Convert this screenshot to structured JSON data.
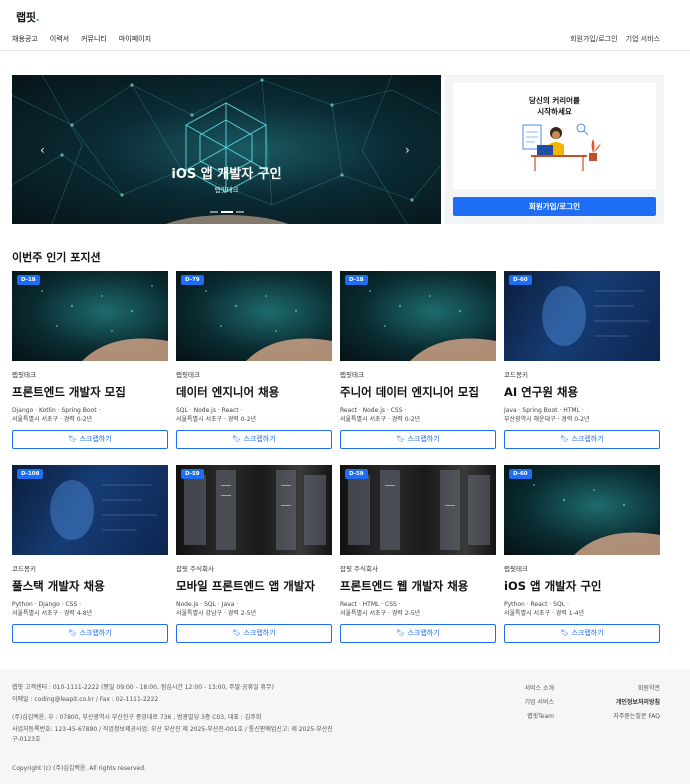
{
  "header": {
    "logo": "랩핏",
    "logo_dot": ".",
    "nav": [
      "채용공고",
      "이력서",
      "커뮤니티",
      "마이페이지"
    ],
    "right": [
      "회원가입/로그인",
      "기업 서비스"
    ]
  },
  "hero": {
    "title": "iOS 앱 개발자 구인",
    "subtitle": "랩핏테크",
    "prev": "‹",
    "next": "›"
  },
  "side": {
    "line1": "당신의 커리어를",
    "line2": "시작하세요",
    "button": "회원가입/로그인"
  },
  "section_title": "이번주 인기 포지션",
  "cards": [
    {
      "dday": "D-18",
      "company": "랩핏테크",
      "title": "프론트엔드 개발자 모집",
      "skills": "Django · Kotlin · Spring Boot ·",
      "location": "서울특별시 서초구 · 경력 0-2년",
      "scrap": "스크랩하기"
    },
    {
      "dday": "D-79",
      "company": "랩핏테크",
      "title": "데이터 엔지니어 채용",
      "skills": "SQL · Node.js · React ·",
      "location": "서울특별시 서초구 · 경력 0-2년",
      "scrap": "스크랩하기"
    },
    {
      "dday": "D-18",
      "company": "랩핏테크",
      "title": "주니어 데이터 엔지니어 모집",
      "skills": "React · Node.js · CSS ·",
      "location": "서울특별시 서초구 · 경력 0-2년",
      "scrap": "스크랩하기"
    },
    {
      "dday": "D-60",
      "company": "코드몽키",
      "title": "AI 연구원 채용",
      "skills": "Java · Spring Boot · HTML ·",
      "location": "부산광역시 해운대구 · 경력 0-2년",
      "scrap": "스크랩하기"
    },
    {
      "dday": "D-108",
      "company": "코드몽키",
      "title": "풀스택 개발자 채용",
      "skills": "Python · Django · CSS ·",
      "location": "서울특별시 서초구 · 경력 4-8년",
      "scrap": "스크랩하기"
    },
    {
      "dday": "D-59",
      "company": "잡핏 주식회사",
      "title": "모바일 프론트엔드 앱 개발자",
      "skills": "Node.js · SQL · Java ·",
      "location": "서울특별시 강남구 · 경력 2-5년",
      "scrap": "스크랩하기"
    },
    {
      "dday": "D-59",
      "company": "잡핏 주식회사",
      "title": "프론트엔드 웹 개발자 채용",
      "skills": "React · HTML · CSS ·",
      "location": "서울특별시 서초구 · 경력 2-5년",
      "scrap": "스크랩하기"
    },
    {
      "dday": "D-60",
      "company": "랩핏테크",
      "title": "iOS 앱 개발자 구인",
      "skills": "Python · React · SQL ·",
      "location": "서울특별시 서초구 · 경력 1-4년",
      "scrap": "스크랩하기"
    }
  ],
  "footer": {
    "center": "랩핏 고객센터 : 010-1111-2222 (평일 09:00 - 18:00, 점심시간 12:00 - 13:00, 주말·공휴일 휴무)",
    "email": "이메일 : coding@leapit.co.kr / Fax : 02-1111-2222",
    "company": "(주)심김백윤, 우 : 07800, 부산광역시 부산진구 중앙대로 736 , 범광빌딩 3층 C03, 대표 : 김주희",
    "reg1": "사업자등록번호: 123-45-67890 / 직업정보제공사업: 부산 부산진 제 2025-부산진-001호 / 통신판매업신고: 제 2025-부산진",
    "reg2": "구-0123호",
    "copyright": "Copyright (c) (주)심김백윤. All rights reserved.",
    "col1": [
      "서비스 소개",
      "기업 서비스",
      "랩핏Team"
    ],
    "col2": [
      "회원약관",
      "개인정보처리방침",
      "자주묻는질문 FAQ"
    ]
  }
}
